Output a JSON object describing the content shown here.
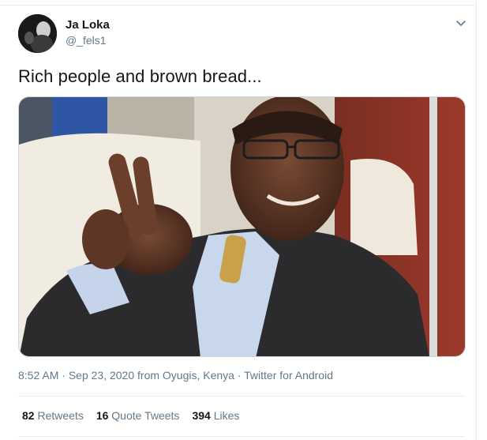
{
  "tweet": {
    "author": {
      "display_name": "Ja Loka",
      "handle": "@_fels1",
      "avatar_icon": "profile-photo"
    },
    "text": "Rich people and brown bread...",
    "media": {
      "type": "photo"
    },
    "meta": {
      "time": "8:52 AM",
      "date": "Sep 23, 2020",
      "location": "from Oyugis, Kenya",
      "source": "Twitter for Android",
      "separator": " · "
    },
    "stats": {
      "retweets_count": "82",
      "retweets_label": "Retweets",
      "quotes_count": "16",
      "quotes_label": "Quote Tweets",
      "likes_count": "394",
      "likes_label": "Likes"
    },
    "caret_icon": "chevron-down-icon"
  },
  "colors": {
    "text_primary": "#14171a",
    "text_secondary": "#657786",
    "border": "#e6ecf0"
  }
}
